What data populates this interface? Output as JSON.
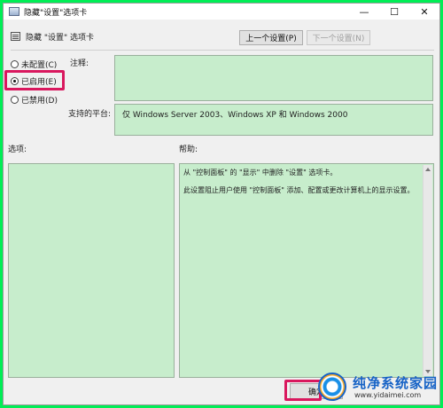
{
  "window": {
    "title": "隐藏\"设置\"选项卡",
    "controls": {
      "minimize": "—",
      "maximize": "☐",
      "close": "✕"
    }
  },
  "header": {
    "title": "隐藏 \"设置\" 选项卡",
    "prev_button": "上一个设置(P)",
    "next_button": "下一个设置(N)"
  },
  "state": {
    "options": [
      {
        "label": "未配置(C)",
        "selected": false
      },
      {
        "label": "已启用(E)",
        "selected": true
      },
      {
        "label": "已禁用(D)",
        "selected": false
      }
    ]
  },
  "comment": {
    "label": "注释:",
    "value": ""
  },
  "platform": {
    "label": "支持的平台:",
    "value": "仅 Windows Server 2003、Windows XP 和 Windows 2000"
  },
  "options_label": "选项:",
  "help": {
    "label": "帮助:",
    "line1": "从 \"控制面板\" 的 \"显示\" 中删除 \"设置\" 选项卡。",
    "line2": "此设置阻止用户使用 \"控制面板\" 添加、配置或更改计算机上的显示设置。"
  },
  "footer": {
    "ok_button": "确定"
  },
  "watermark": {
    "text": "纯净系统家园",
    "url": "www.yidaimei.com"
  },
  "colors": {
    "highlight": "#d9185e",
    "field_bg": "#c7edcc",
    "page_bg": "#00ee55"
  }
}
